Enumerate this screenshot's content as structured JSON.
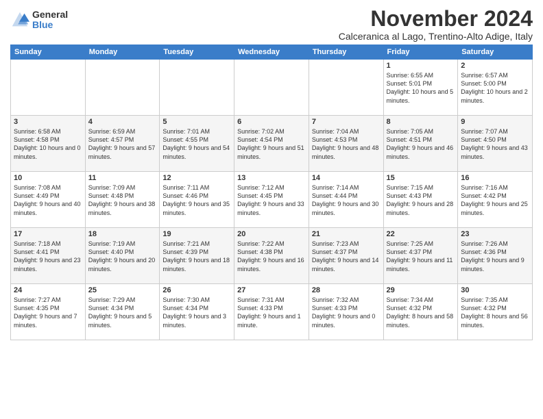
{
  "header": {
    "logo_general": "General",
    "logo_blue": "Blue",
    "month_title": "November 2024",
    "location": "Calceranica al Lago, Trentino-Alto Adige, Italy"
  },
  "columns": [
    "Sunday",
    "Monday",
    "Tuesday",
    "Wednesday",
    "Thursday",
    "Friday",
    "Saturday"
  ],
  "weeks": [
    [
      {
        "day": "",
        "info": ""
      },
      {
        "day": "",
        "info": ""
      },
      {
        "day": "",
        "info": ""
      },
      {
        "day": "",
        "info": ""
      },
      {
        "day": "",
        "info": ""
      },
      {
        "day": "1",
        "info": "Sunrise: 6:55 AM\nSunset: 5:01 PM\nDaylight: 10 hours and 5 minutes."
      },
      {
        "day": "2",
        "info": "Sunrise: 6:57 AM\nSunset: 5:00 PM\nDaylight: 10 hours and 2 minutes."
      }
    ],
    [
      {
        "day": "3",
        "info": "Sunrise: 6:58 AM\nSunset: 4:58 PM\nDaylight: 10 hours and 0 minutes."
      },
      {
        "day": "4",
        "info": "Sunrise: 6:59 AM\nSunset: 4:57 PM\nDaylight: 9 hours and 57 minutes."
      },
      {
        "day": "5",
        "info": "Sunrise: 7:01 AM\nSunset: 4:55 PM\nDaylight: 9 hours and 54 minutes."
      },
      {
        "day": "6",
        "info": "Sunrise: 7:02 AM\nSunset: 4:54 PM\nDaylight: 9 hours and 51 minutes."
      },
      {
        "day": "7",
        "info": "Sunrise: 7:04 AM\nSunset: 4:53 PM\nDaylight: 9 hours and 48 minutes."
      },
      {
        "day": "8",
        "info": "Sunrise: 7:05 AM\nSunset: 4:51 PM\nDaylight: 9 hours and 46 minutes."
      },
      {
        "day": "9",
        "info": "Sunrise: 7:07 AM\nSunset: 4:50 PM\nDaylight: 9 hours and 43 minutes."
      }
    ],
    [
      {
        "day": "10",
        "info": "Sunrise: 7:08 AM\nSunset: 4:49 PM\nDaylight: 9 hours and 40 minutes."
      },
      {
        "day": "11",
        "info": "Sunrise: 7:09 AM\nSunset: 4:48 PM\nDaylight: 9 hours and 38 minutes."
      },
      {
        "day": "12",
        "info": "Sunrise: 7:11 AM\nSunset: 4:46 PM\nDaylight: 9 hours and 35 minutes."
      },
      {
        "day": "13",
        "info": "Sunrise: 7:12 AM\nSunset: 4:45 PM\nDaylight: 9 hours and 33 minutes."
      },
      {
        "day": "14",
        "info": "Sunrise: 7:14 AM\nSunset: 4:44 PM\nDaylight: 9 hours and 30 minutes."
      },
      {
        "day": "15",
        "info": "Sunrise: 7:15 AM\nSunset: 4:43 PM\nDaylight: 9 hours and 28 minutes."
      },
      {
        "day": "16",
        "info": "Sunrise: 7:16 AM\nSunset: 4:42 PM\nDaylight: 9 hours and 25 minutes."
      }
    ],
    [
      {
        "day": "17",
        "info": "Sunrise: 7:18 AM\nSunset: 4:41 PM\nDaylight: 9 hours and 23 minutes."
      },
      {
        "day": "18",
        "info": "Sunrise: 7:19 AM\nSunset: 4:40 PM\nDaylight: 9 hours and 20 minutes."
      },
      {
        "day": "19",
        "info": "Sunrise: 7:21 AM\nSunset: 4:39 PM\nDaylight: 9 hours and 18 minutes."
      },
      {
        "day": "20",
        "info": "Sunrise: 7:22 AM\nSunset: 4:38 PM\nDaylight: 9 hours and 16 minutes."
      },
      {
        "day": "21",
        "info": "Sunrise: 7:23 AM\nSunset: 4:37 PM\nDaylight: 9 hours and 14 minutes."
      },
      {
        "day": "22",
        "info": "Sunrise: 7:25 AM\nSunset: 4:37 PM\nDaylight: 9 hours and 11 minutes."
      },
      {
        "day": "23",
        "info": "Sunrise: 7:26 AM\nSunset: 4:36 PM\nDaylight: 9 hours and 9 minutes."
      }
    ],
    [
      {
        "day": "24",
        "info": "Sunrise: 7:27 AM\nSunset: 4:35 PM\nDaylight: 9 hours and 7 minutes."
      },
      {
        "day": "25",
        "info": "Sunrise: 7:29 AM\nSunset: 4:34 PM\nDaylight: 9 hours and 5 minutes."
      },
      {
        "day": "26",
        "info": "Sunrise: 7:30 AM\nSunset: 4:34 PM\nDaylight: 9 hours and 3 minutes."
      },
      {
        "day": "27",
        "info": "Sunrise: 7:31 AM\nSunset: 4:33 PM\nDaylight: 9 hours and 1 minute."
      },
      {
        "day": "28",
        "info": "Sunrise: 7:32 AM\nSunset: 4:33 PM\nDaylight: 9 hours and 0 minutes."
      },
      {
        "day": "29",
        "info": "Sunrise: 7:34 AM\nSunset: 4:32 PM\nDaylight: 8 hours and 58 minutes."
      },
      {
        "day": "30",
        "info": "Sunrise: 7:35 AM\nSunset: 4:32 PM\nDaylight: 8 hours and 56 minutes."
      }
    ]
  ]
}
